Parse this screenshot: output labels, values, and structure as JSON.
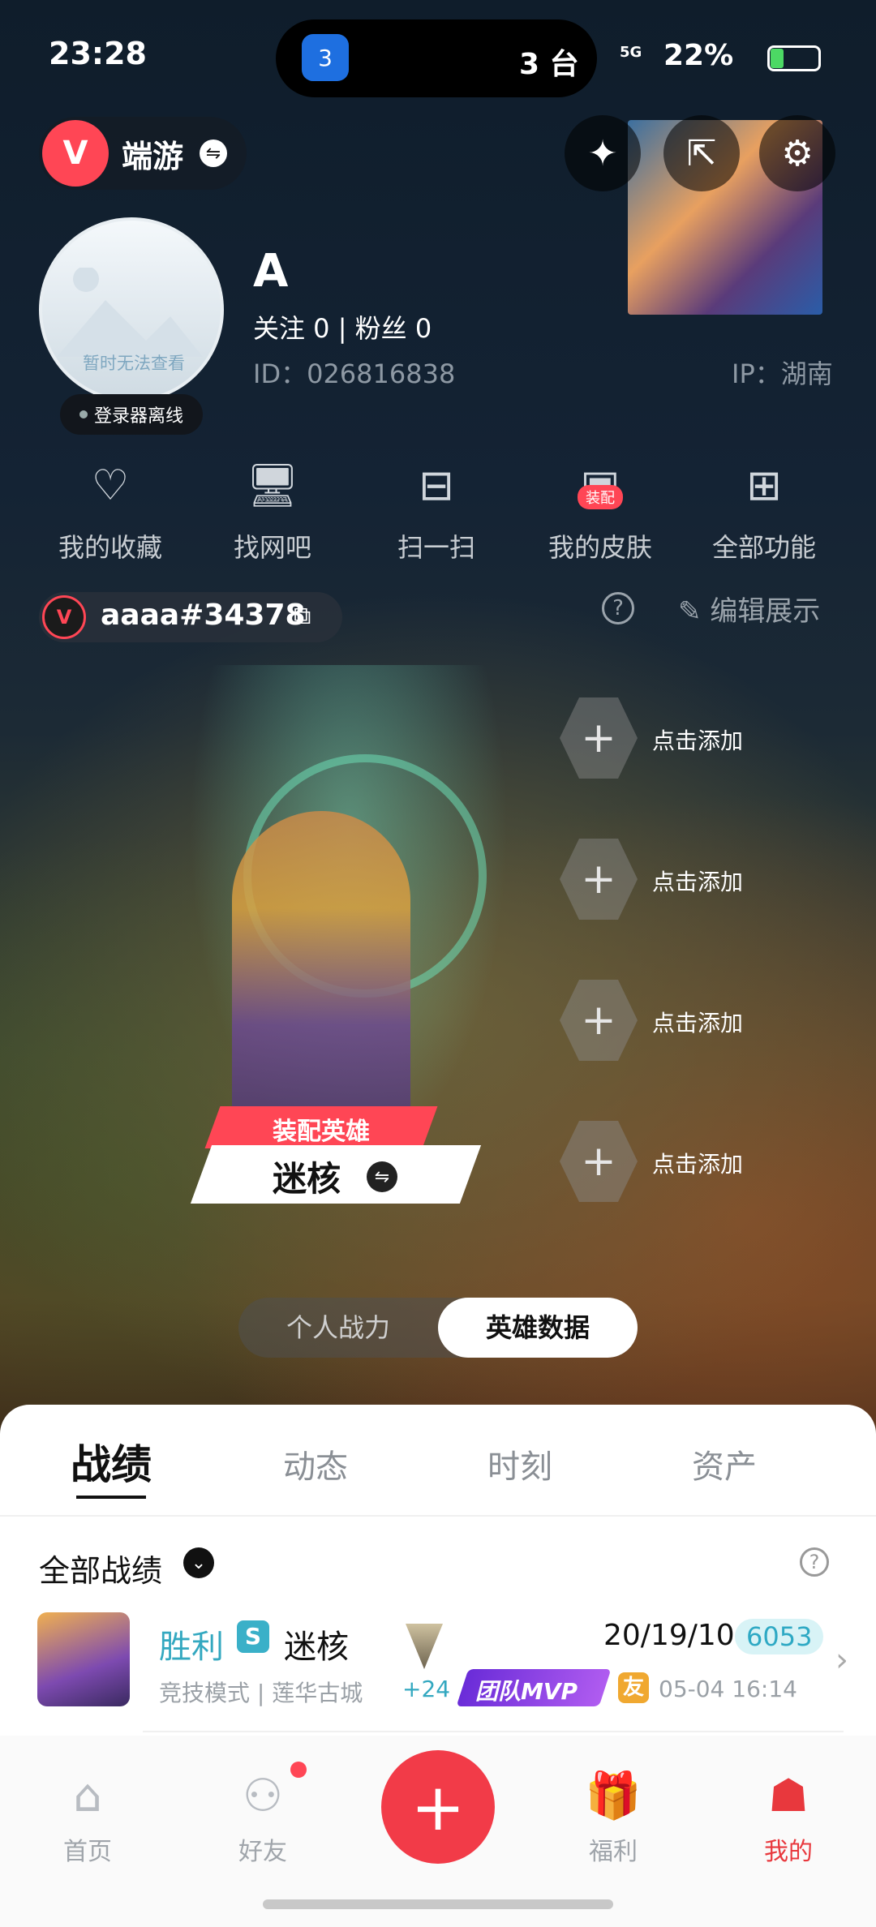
{
  "status_bar": {
    "time": "23:28",
    "island_app_badge": "3",
    "island_text": "3 台",
    "signal": "5G",
    "battery": "22%"
  },
  "header": {
    "game_logo_text": "V",
    "game_name": "端游",
    "swap_icon": "⇋",
    "icons": [
      "sparkle-icon",
      "share-icon",
      "settings-icon"
    ]
  },
  "profile": {
    "avatar_text": "暂时无法查看",
    "online_status": "登录器离线",
    "name": "A",
    "follow": "关注 0  |  粉丝 0",
    "id": "ID：026816838",
    "ip": "IP：湖南"
  },
  "quick_actions": [
    {
      "label": "我的收藏",
      "icon": "♡"
    },
    {
      "label": "找网吧",
      "icon": "🖥"
    },
    {
      "label": "扫一扫",
      "icon": "⊟"
    },
    {
      "label": "我的皮肤",
      "icon": "▣",
      "badge": "装配"
    },
    {
      "label": "全部功能",
      "icon": "⊞"
    }
  ],
  "riot_id": {
    "name": "aaaa#34378",
    "logo_text": "V"
  },
  "edit_label": "编辑展示",
  "agent": {
    "equip_label": "装配英雄",
    "name": "迷核"
  },
  "slots": [
    {
      "label": "点击添加"
    },
    {
      "label": "点击添加"
    },
    {
      "label": "点击添加"
    },
    {
      "label": "点击添加"
    }
  ],
  "toggle": {
    "options": [
      "个人战力",
      "英雄数据"
    ],
    "active": "英雄数据"
  },
  "tabs": [
    "战绩",
    "动态",
    "时刻",
    "资产"
  ],
  "filter_label": "全部战绩",
  "match": {
    "result": "胜利",
    "rank_letter": "S",
    "agent": "迷核",
    "kda": "20/19/10",
    "score": "6053",
    "mode_map": "竞技模式 | 莲华古城",
    "rr": "+24",
    "mvp": "团队MVP",
    "friend_badge": "友",
    "time": "05-04 16:14"
  },
  "nav": [
    {
      "label": "首页",
      "icon": "⌂"
    },
    {
      "label": "好友",
      "icon": "⚇"
    },
    {
      "label": "",
      "icon": "+"
    },
    {
      "label": "福利",
      "icon": "🎁"
    },
    {
      "label": "我的",
      "icon": "☗"
    }
  ],
  "colors": {
    "accent": "#ff4655",
    "win": "#33a8c0",
    "nav_active": "#e8383d"
  }
}
